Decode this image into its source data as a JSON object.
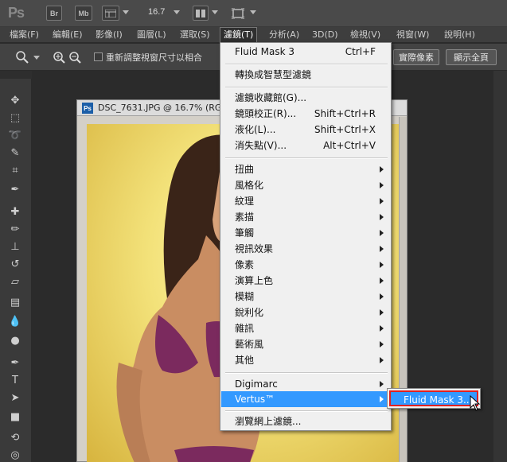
{
  "appbar": {
    "logo": "Ps",
    "bridge_label": "Br",
    "minibridge_label": "Mb",
    "zoom_value": "16.7"
  },
  "menubar": {
    "items": [
      {
        "label": "檔案(F)"
      },
      {
        "label": "編輯(E)"
      },
      {
        "label": "影像(I)"
      },
      {
        "label": "圖層(L)"
      },
      {
        "label": "選取(S)"
      },
      {
        "label": "濾鏡(T)"
      },
      {
        "label": "分析(A)"
      },
      {
        "label": "3D(D)"
      },
      {
        "label": "檢視(V)"
      },
      {
        "label": "視窗(W)"
      },
      {
        "label": "說明(H)"
      }
    ]
  },
  "options": {
    "fit_label": "重新調整視窗尺寸以相合",
    "actual_pixels_label": "實際像素",
    "fit_screen_label": "顯示全頁"
  },
  "document": {
    "title": "DSC_7631.JPG @ 16.7% (RGB"
  },
  "filter_menu": {
    "last_filter": {
      "label": "Fluid Mask 3",
      "shortcut": "Ctrl+F"
    },
    "smart_filter": "轉換成智慧型濾鏡",
    "gallery": {
      "label": "濾鏡收藏館(G)..."
    },
    "lens": {
      "label": "鏡頭校正(R)...",
      "shortcut": "Shift+Ctrl+R"
    },
    "liquify": {
      "label": "液化(L)...",
      "shortcut": "Shift+Ctrl+X"
    },
    "vanishing": {
      "label": "消失點(V)...",
      "shortcut": "Alt+Ctrl+V"
    },
    "groups": [
      "扭曲",
      "風格化",
      "紋理",
      "素描",
      "筆觸",
      "視訊效果",
      "像素",
      "演算上色",
      "模糊",
      "銳利化",
      "雜訊",
      "藝術風",
      "其他"
    ],
    "digimarc": "Digimarc",
    "vertus": "Vertus™",
    "browse_online": "瀏覽網上濾鏡..."
  },
  "submenu": {
    "item": "Fluid Mask 3..."
  }
}
